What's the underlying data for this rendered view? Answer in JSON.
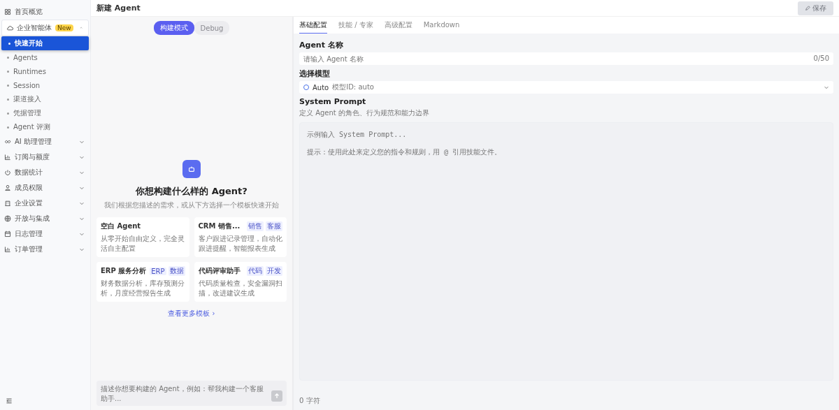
{
  "sidebar": {
    "items": [
      {
        "label": "首页概览"
      },
      {
        "label": "企业智能体",
        "badge": "New",
        "expanded": true,
        "children": [
          {
            "label": "快速开始",
            "selected": true
          },
          {
            "label": "Agents",
            "selected": false
          },
          {
            "label": "Runtimes",
            "selected": false
          },
          {
            "label": "Session",
            "selected": false
          },
          {
            "label": "渠道接入",
            "selected": false
          },
          {
            "label": "凭据管理",
            "selected": false
          },
          {
            "label": "Agent 评测",
            "selected": false
          }
        ]
      },
      {
        "label": "AI 助理管理",
        "expanded": false
      },
      {
        "label": "订阅与额度",
        "expanded": false
      },
      {
        "label": "数据统计",
        "expanded": false
      },
      {
        "label": "成员权限",
        "expanded": false
      },
      {
        "label": "企业设置",
        "expanded": false
      },
      {
        "label": "开放与集成",
        "expanded": false
      },
      {
        "label": "日志管理",
        "expanded": false
      },
      {
        "label": "订单管理",
        "expanded": false
      }
    ]
  },
  "header": {
    "title": "新建 Agent",
    "save_button": {
      "label": "保存",
      "disabled": true
    }
  },
  "chat": {
    "modes": [
      {
        "label": "构建模式",
        "selected": true
      },
      {
        "label": "Debug",
        "selected": false
      }
    ],
    "heading": "你想构建什么样的 Agent?",
    "subheading": "我们根据您描述的需求，或从下方选择一个模板快速开始",
    "templates": [
      {
        "title": "空白 Agent",
        "description": "从零开始自由定义，完全灵活自主配置"
      },
      {
        "title": "CRM 销售...",
        "tags": [
          "销售",
          "客服"
        ],
        "description": "客户跟进记录管理，自动化跟进提醒，智能报表生成"
      },
      {
        "title": "ERP 服务分析",
        "tags": [
          "ERP",
          "数据"
        ],
        "description": "财务数据分析，库存预测分析，月度经营报告生成"
      },
      {
        "title": "代码评审助手",
        "tags": [
          "代码",
          "开发"
        ],
        "description": "代码质量检查，安全漏洞扫描，改进建议生成"
      }
    ],
    "more_link": "查看更多模板 ›",
    "input_placeholder": "描述你想要构建的 Agent，例如：帮我构建一个客服助手..."
  },
  "config": {
    "tabs": [
      {
        "label": "基础配置",
        "selected": true
      },
      {
        "label": "技能 / 专家",
        "selected": false
      },
      {
        "label": "高级配置",
        "selected": false
      },
      {
        "label": "Markdown",
        "selected": false
      }
    ],
    "name_label": "Agent 名称",
    "name_placeholder": "请输入 Agent 名称",
    "name_counter": "0/50",
    "model_label": "选择模型",
    "model_value": "Auto",
    "model_id": "模型ID: auto",
    "prompt_label": "System Prompt",
    "prompt_hint": "定义 Agent 的角色、行为规范和能力边界",
    "prompt_placeholder": [
      "示例输入 System Prompt...",
      "提示：使用此处来定义您的指令和规则，用 @ 引用技能文件。"
    ],
    "prompt_counter": "0 字符"
  }
}
